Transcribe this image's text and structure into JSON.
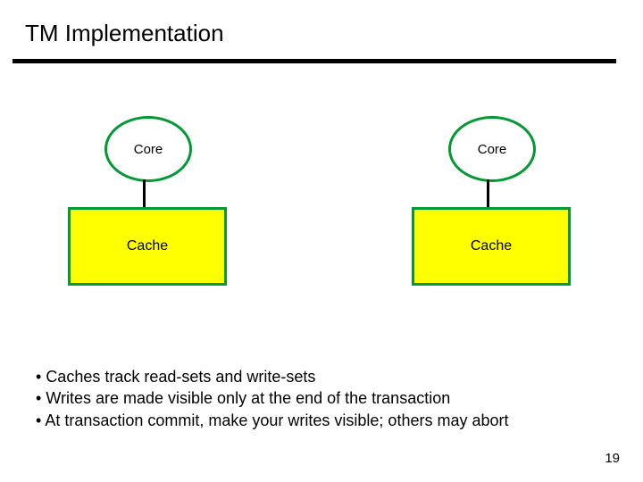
{
  "title": "TM Implementation",
  "nodes": {
    "core_left": "Core",
    "core_right": "Core",
    "cache_left": "Cache",
    "cache_right": "Cache"
  },
  "bullets": [
    "Caches track read-sets and write-sets",
    "Writes are made visible only at the end of the transaction",
    "At transaction commit, make your writes visible; others may abort"
  ],
  "page_number": "19"
}
